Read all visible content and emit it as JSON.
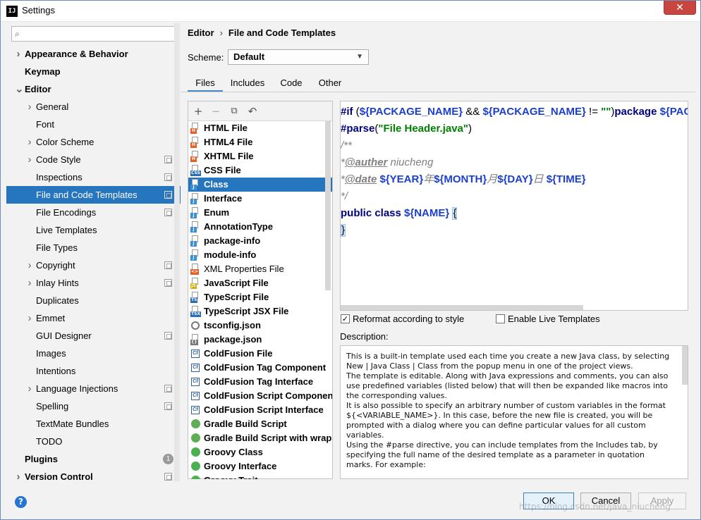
{
  "window": {
    "title": "Settings",
    "app_icon": "IJ",
    "close_glyph": "✕"
  },
  "search": {
    "placeholder": ""
  },
  "sidebar": {
    "items": [
      {
        "label": "Appearance & Behavior",
        "level": 0,
        "bold": true,
        "arrow": "right",
        "badge": ""
      },
      {
        "label": "Keymap",
        "level": 0,
        "bold": true,
        "arrow": "",
        "badge": ""
      },
      {
        "label": "Editor",
        "level": 0,
        "bold": true,
        "arrow": "down",
        "badge": ""
      },
      {
        "label": "General",
        "level": 1,
        "bold": false,
        "arrow": "right",
        "badge": ""
      },
      {
        "label": "Font",
        "level": 1,
        "bold": false,
        "arrow": "",
        "badge": ""
      },
      {
        "label": "Color Scheme",
        "level": 1,
        "bold": false,
        "arrow": "right",
        "badge": ""
      },
      {
        "label": "Code Style",
        "level": 1,
        "bold": false,
        "arrow": "right",
        "badge": "project"
      },
      {
        "label": "Inspections",
        "level": 1,
        "bold": false,
        "arrow": "",
        "badge": "project"
      },
      {
        "label": "File and Code Templates",
        "level": 1,
        "bold": false,
        "arrow": "",
        "badge": "project",
        "selected": true
      },
      {
        "label": "File Encodings",
        "level": 1,
        "bold": false,
        "arrow": "",
        "badge": "project"
      },
      {
        "label": "Live Templates",
        "level": 1,
        "bold": false,
        "arrow": "",
        "badge": ""
      },
      {
        "label": "File Types",
        "level": 1,
        "bold": false,
        "arrow": "",
        "badge": ""
      },
      {
        "label": "Copyright",
        "level": 1,
        "bold": false,
        "arrow": "right",
        "badge": "project"
      },
      {
        "label": "Inlay Hints",
        "level": 1,
        "bold": false,
        "arrow": "right",
        "badge": "project"
      },
      {
        "label": "Duplicates",
        "level": 1,
        "bold": false,
        "arrow": "",
        "badge": ""
      },
      {
        "label": "Emmet",
        "level": 1,
        "bold": false,
        "arrow": "right",
        "badge": ""
      },
      {
        "label": "GUI Designer",
        "level": 1,
        "bold": false,
        "arrow": "",
        "badge": "project"
      },
      {
        "label": "Images",
        "level": 1,
        "bold": false,
        "arrow": "",
        "badge": ""
      },
      {
        "label": "Intentions",
        "level": 1,
        "bold": false,
        "arrow": "",
        "badge": ""
      },
      {
        "label": "Language Injections",
        "level": 1,
        "bold": false,
        "arrow": "right",
        "badge": "project"
      },
      {
        "label": "Spelling",
        "level": 1,
        "bold": false,
        "arrow": "",
        "badge": "project"
      },
      {
        "label": "TextMate Bundles",
        "level": 1,
        "bold": false,
        "arrow": "",
        "badge": ""
      },
      {
        "label": "TODO",
        "level": 1,
        "bold": false,
        "arrow": "",
        "badge": ""
      },
      {
        "label": "Plugins",
        "level": 0,
        "bold": true,
        "arrow": "",
        "badge": "count",
        "count": "1"
      },
      {
        "label": "Version Control",
        "level": 0,
        "bold": true,
        "arrow": "right",
        "badge": "project"
      }
    ]
  },
  "breadcrumb": {
    "parent": "Editor",
    "separator": "›",
    "current": "File and Code Templates"
  },
  "scheme": {
    "label": "Scheme:",
    "value": "Default"
  },
  "tabs": [
    {
      "label": "Files",
      "active": true
    },
    {
      "label": "Includes",
      "active": false
    },
    {
      "label": "Code",
      "active": false
    },
    {
      "label": "Other",
      "active": false
    }
  ],
  "toolbar": {
    "add": "+",
    "remove": "−",
    "copy": "⧉",
    "reset": "↶"
  },
  "files": [
    {
      "label": "HTML File",
      "icon": "html",
      "tag": "H",
      "color": "#e0632d",
      "bold": true
    },
    {
      "label": "HTML4 File",
      "icon": "html",
      "tag": "H",
      "color": "#e0632d",
      "bold": true
    },
    {
      "label": "XHTML File",
      "icon": "html",
      "tag": "H",
      "color": "#e0632d",
      "bold": true
    },
    {
      "label": "CSS File",
      "icon": "css",
      "tag": "CSS",
      "color": "#2d6db5",
      "bold": true
    },
    {
      "label": "Class",
      "icon": "java",
      "tag": "J",
      "color": "#3a8fd6",
      "bold": true,
      "selected": true
    },
    {
      "label": "Interface",
      "icon": "java",
      "tag": "J",
      "color": "#3a8fd6",
      "bold": true
    },
    {
      "label": "Enum",
      "icon": "java",
      "tag": "J",
      "color": "#3a8fd6",
      "bold": true
    },
    {
      "label": "AnnotationType",
      "icon": "java",
      "tag": "J",
      "color": "#3a8fd6",
      "bold": true
    },
    {
      "label": "package-info",
      "icon": "java",
      "tag": "J",
      "color": "#3a8fd6",
      "bold": true
    },
    {
      "label": "module-info",
      "icon": "java",
      "tag": "J",
      "color": "#3a8fd6",
      "bold": true
    },
    {
      "label": "XML Properties File",
      "icon": "xml",
      "tag": "<>",
      "color": "#e0632d",
      "bold": false
    },
    {
      "label": "JavaScript File",
      "icon": "js",
      "tag": "JS",
      "color": "#d4a90e",
      "bold": true
    },
    {
      "label": "TypeScript File",
      "icon": "ts",
      "tag": "TS",
      "color": "#2d6db5",
      "bold": true
    },
    {
      "label": "TypeScript JSX File",
      "icon": "tsx",
      "tag": "TSX",
      "color": "#2d6db5",
      "bold": true
    },
    {
      "label": "tsconfig.json",
      "icon": "gear",
      "tag": "",
      "color": "#777777",
      "bold": true
    },
    {
      "label": "package.json",
      "icon": "json",
      "tag": "{}",
      "color": "#777777",
      "bold": true
    },
    {
      "label": "ColdFusion File",
      "icon": "cf",
      "tag": "Cf",
      "color": "#2a5ea8",
      "bold": true
    },
    {
      "label": "ColdFusion Tag Component",
      "icon": "cf",
      "tag": "Cf",
      "color": "#2a5ea8",
      "bold": true
    },
    {
      "label": "ColdFusion Tag Interface",
      "icon": "cf",
      "tag": "Cf",
      "color": "#2a5ea8",
      "bold": true
    },
    {
      "label": "ColdFusion Script Component",
      "icon": "cf",
      "tag": "Cf",
      "color": "#2a5ea8",
      "bold": true
    },
    {
      "label": "ColdFusion Script Interface",
      "icon": "cf",
      "tag": "Cf",
      "color": "#2a5ea8",
      "bold": true
    },
    {
      "label": "Gradle Build Script",
      "icon": "gradle",
      "tag": "G",
      "color": "#5fad56",
      "bold": true
    },
    {
      "label": "Gradle Build Script with wrapper",
      "icon": "gradle",
      "tag": "G",
      "color": "#5fad56",
      "bold": true
    },
    {
      "label": "Groovy Class",
      "icon": "groovy",
      "tag": "G",
      "color": "#4caf50",
      "bold": true
    },
    {
      "label": "Groovy Interface",
      "icon": "groovy",
      "tag": "G",
      "color": "#4caf50",
      "bold": true
    },
    {
      "label": "Groovy Trait",
      "icon": "groovy",
      "tag": "G",
      "color": "#4caf50",
      "bold": true
    }
  ],
  "editor": {
    "lines": [
      [
        {
          "t": "#if",
          "c": "kw"
        },
        {
          "t": " (",
          "c": "plain"
        },
        {
          "t": "${PACKAGE_NAME}",
          "c": "var"
        },
        {
          "t": " && ",
          "c": "plain"
        },
        {
          "t": "${PACKAGE_NAME}",
          "c": "var"
        },
        {
          "t": " != ",
          "c": "plain"
        },
        {
          "t": "\"\"",
          "c": "str"
        },
        {
          "t": ")",
          "c": "plain"
        },
        {
          "t": "package ",
          "c": "kw"
        },
        {
          "t": "${PACKAGE_NAME}",
          "c": "var"
        }
      ],
      [
        {
          "t": "#parse",
          "c": "kw"
        },
        {
          "t": "(",
          "c": "plain"
        },
        {
          "t": "\"File Header.java\"",
          "c": "str"
        },
        {
          "t": ")",
          "c": "plain"
        }
      ],
      [
        {
          "t": "/**",
          "c": "cmt"
        }
      ],
      [
        {
          "t": " *",
          "c": "cmt"
        },
        {
          "t": "@auther",
          "c": "tagcmt"
        },
        {
          "t": "   niucheng",
          "c": "cmt"
        }
      ],
      [
        {
          "t": " *",
          "c": "cmt"
        },
        {
          "t": "@date",
          "c": "tagcmt"
        },
        {
          "t": "     ",
          "c": "cmt"
        },
        {
          "t": "${YEAR}",
          "c": "var"
        },
        {
          "t": "年",
          "c": "cmt"
        },
        {
          "t": "${MONTH}",
          "c": "var"
        },
        {
          "t": "月",
          "c": "cmt"
        },
        {
          "t": "${DAY}",
          "c": "var"
        },
        {
          "t": "日    ",
          "c": "cmt"
        },
        {
          "t": "${TIME}",
          "c": "var"
        }
      ],
      [
        {
          "t": " */",
          "c": "cmt"
        }
      ],
      [
        {
          "t": "public class ",
          "c": "kw"
        },
        {
          "t": "${NAME}",
          "c": "var"
        },
        {
          "t": " ",
          "c": "plain"
        },
        {
          "t": "{",
          "c": "caret"
        }
      ],
      [
        {
          "t": "}",
          "c": "caret"
        }
      ]
    ]
  },
  "options": {
    "reformat": {
      "label": "Reformat according to style",
      "checked": true
    },
    "live_templates": {
      "label": "Enable Live Templates",
      "checked": false
    }
  },
  "description": {
    "label": "Description:",
    "paragraphs": [
      "This is a built-in template used each time you create a new Java class, by selecting New | Java Class | Class from the popup menu in one of the project views.",
      "The template is editable. Along with Java expressions and comments, you can also use predefined variables (listed below) that will then be expanded like macros into the corresponding values.",
      "It is also possible to specify an arbitrary number of custom variables in the format ${<VARIABLE_NAME>}. In this case, before the new file is created, you will be prompted with a dialog where you can define particular values for all custom variables.",
      "Using the #parse directive, you can include templates from the Includes tab, by specifying the full name of the desired template as a parameter in quotation marks. For example:"
    ]
  },
  "buttons": {
    "help": "?",
    "ok": "OK",
    "cancel": "Cancel",
    "apply": "Apply"
  },
  "watermark": "https://blog.csdn.net/java_niucheng",
  "colors": {
    "selection": "#2675bf",
    "accent": "#4a88c7",
    "keyword": "#000080",
    "variable": "#1a3fd1",
    "string": "#008000",
    "comment": "#808080"
  }
}
